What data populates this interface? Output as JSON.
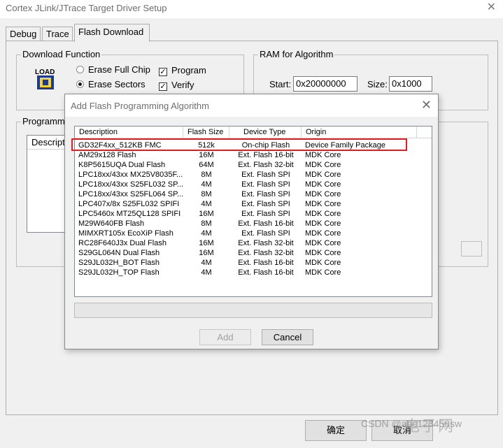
{
  "window": {
    "title": "Cortex JLink/JTrace Target Driver Setup",
    "close_glyph": "✕"
  },
  "tabs": [
    {
      "label": "Debug"
    },
    {
      "label": "Trace"
    },
    {
      "label": "Flash Download"
    }
  ],
  "download_function": {
    "title": "Download Function",
    "load_icon_text": "LOAD",
    "erase_full_chip": "Erase Full Chip",
    "erase_sectors": "Erase Sectors",
    "program": "Program",
    "verify": "Verify"
  },
  "ram": {
    "title": "RAM for Algorithm",
    "start_label": "Start:",
    "start_value": "0x20000000",
    "size_label": "Size:",
    "size_value": "0x1000"
  },
  "programming": {
    "title_partial": "Programm",
    "desc_header_partial": "Descript"
  },
  "dialog": {
    "title": "Add Flash Programming Algorithm",
    "columns": [
      "Description",
      "Flash Size",
      "Device Type",
      "Origin"
    ],
    "rows": [
      {
        "desc": "GD32F4xx_512KB FMC",
        "size": "512k",
        "type": "On-chip Flash",
        "origin": "Device Family Package"
      },
      {
        "desc": "AM29x128 Flash",
        "size": "16M",
        "type": "Ext. Flash 16-bit",
        "origin": "MDK Core"
      },
      {
        "desc": "K8P5615UQA Dual Flash",
        "size": "64M",
        "type": "Ext. Flash 32-bit",
        "origin": "MDK Core"
      },
      {
        "desc": "LPC18xx/43xx MX25V8035F...",
        "size": "8M",
        "type": "Ext. Flash SPI",
        "origin": "MDK Core"
      },
      {
        "desc": "LPC18xx/43xx S25FL032 SP...",
        "size": "4M",
        "type": "Ext. Flash SPI",
        "origin": "MDK Core"
      },
      {
        "desc": "LPC18xx/43xx S25FL064 SP...",
        "size": "8M",
        "type": "Ext. Flash SPI",
        "origin": "MDK Core"
      },
      {
        "desc": "LPC407x/8x S25FL032 SPIFI",
        "size": "4M",
        "type": "Ext. Flash SPI",
        "origin": "MDK Core"
      },
      {
        "desc": "LPC5460x MT25QL128 SPIFI",
        "size": "16M",
        "type": "Ext. Flash SPI",
        "origin": "MDK Core"
      },
      {
        "desc": "M29W640FB Flash",
        "size": "8M",
        "type": "Ext. Flash 16-bit",
        "origin": "MDK Core"
      },
      {
        "desc": "MIMXRT105x EcoXiP Flash",
        "size": "4M",
        "type": "Ext. Flash SPI",
        "origin": "MDK Core"
      },
      {
        "desc": "RC28F640J3x Dual Flash",
        "size": "16M",
        "type": "Ext. Flash 32-bit",
        "origin": "MDK Core"
      },
      {
        "desc": "S29GL064N Dual Flash",
        "size": "16M",
        "type": "Ext. Flash 32-bit",
        "origin": "MDK Core"
      },
      {
        "desc": "S29JL032H_BOT Flash",
        "size": "4M",
        "type": "Ext. Flash 16-bit",
        "origin": "MDK Core"
      },
      {
        "desc": "S29JL032H_TOP Flash",
        "size": "4M",
        "type": "Ext. Flash 16-bit",
        "origin": "MDK Core"
      }
    ],
    "add_label": "Add",
    "cancel_label": "Cancel",
    "close_glyph": "✕"
  },
  "footer": {
    "ok_label": "确定",
    "cancel_label": "取消"
  },
  "watermark": {
    "text": "CSDN @abc123456sw",
    "logo_text": "电子网"
  },
  "colors": {
    "highlight": "#e01c24"
  }
}
